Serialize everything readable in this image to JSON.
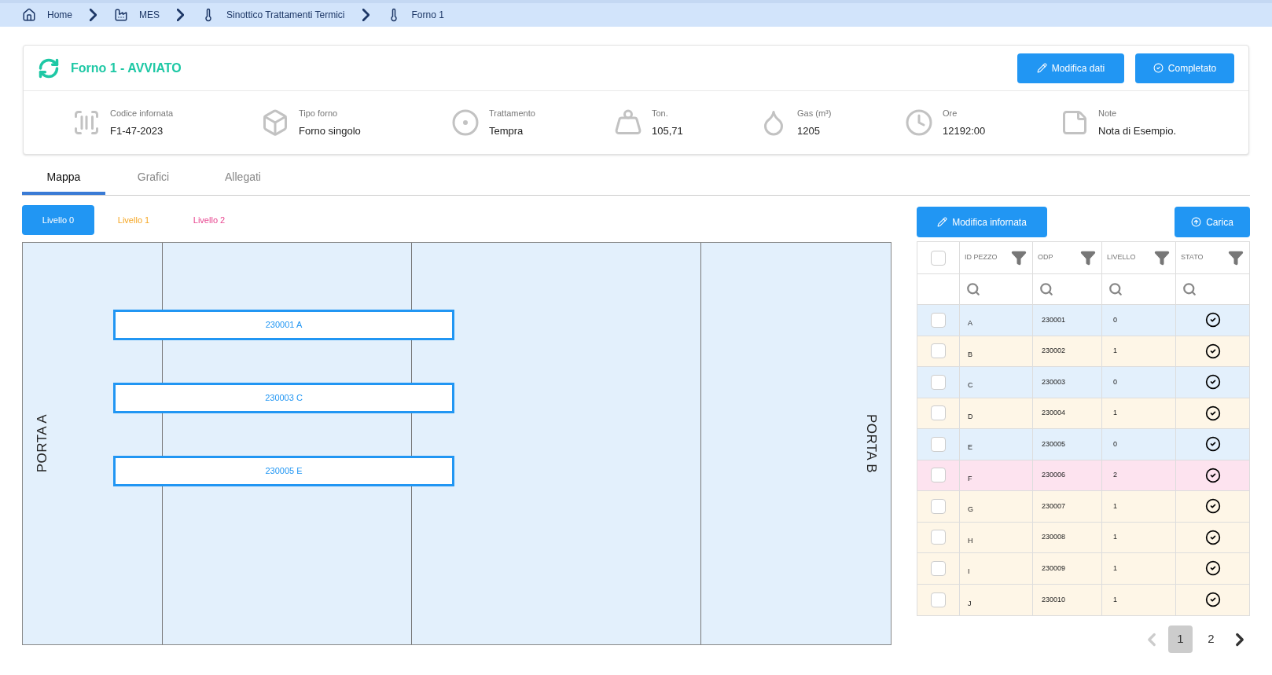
{
  "breadcrumb": [
    {
      "label": "Home"
    },
    {
      "label": "MES"
    },
    {
      "label": "Sinottico Trattamenti Termici"
    },
    {
      "label": "Forno 1"
    }
  ],
  "header": {
    "title": "Forno 1 - AVVIATO",
    "buttons": [
      "Modifica dati",
      "Completato"
    ]
  },
  "info": [
    {
      "label": "Codice infornata",
      "value": "F1-47-2023"
    },
    {
      "label": "Tipo forno",
      "value": "Forno singolo"
    },
    {
      "label": "Trattamento",
      "value": "Tempra"
    },
    {
      "label": "Ton.",
      "value": "105,71"
    },
    {
      "label": "Gas (m³)",
      "value": "1205"
    },
    {
      "label": "Ore",
      "value": "12192:00"
    },
    {
      "label": "Note",
      "value": "Nota di Esempio."
    }
  ],
  "tabs": [
    {
      "label": "Mappa",
      "selected": true
    },
    {
      "label": "Grafici",
      "selected": false
    },
    {
      "label": "Allegati",
      "selected": false
    }
  ],
  "levels": [
    {
      "label": "Livello 0",
      "selected": true,
      "kind": "level0"
    },
    {
      "label": "Livello 1",
      "selected": false,
      "kind": "level1"
    },
    {
      "label": "Livello 2",
      "selected": false,
      "kind": "level2"
    }
  ],
  "map": {
    "door_left": "PORTA A",
    "door_right": "PORTA B",
    "pieces": [
      {
        "label": "230001 A"
      },
      {
        "label": "230003 C"
      },
      {
        "label": "230005 E"
      }
    ]
  },
  "table": {
    "buttons": [
      "Modifica infornata",
      "Carica"
    ],
    "columns": [
      "ID PEZZO",
      "ODP",
      "LIVELLO",
      "STATO"
    ],
    "select_all": {
      "checked": false
    },
    "rows": [
      {
        "id": "A",
        "odp": "230001",
        "livello": "0",
        "checked": false,
        "color": "#e3f0fc"
      },
      {
        "id": "B",
        "odp": "230002",
        "livello": "1",
        "checked": false,
        "color": "#fef6e7"
      },
      {
        "id": "C",
        "odp": "230003",
        "livello": "0",
        "checked": false,
        "color": "#e3f0fc"
      },
      {
        "id": "D",
        "odp": "230004",
        "livello": "1",
        "checked": false,
        "color": "#fef6e7"
      },
      {
        "id": "E",
        "odp": "230005",
        "livello": "0",
        "checked": false,
        "color": "#e3f0fc"
      },
      {
        "id": "F",
        "odp": "230006",
        "livello": "2",
        "checked": false,
        "color": "#fde3ef"
      },
      {
        "id": "G",
        "odp": "230007",
        "livello": "1",
        "checked": false,
        "color": "#fef6e7"
      },
      {
        "id": "H",
        "odp": "230008",
        "livello": "1",
        "checked": false,
        "color": "#fef6e7"
      },
      {
        "id": "I",
        "odp": "230009",
        "livello": "1",
        "checked": false,
        "color": "#fef6e7"
      },
      {
        "id": "J",
        "odp": "230010",
        "livello": "1",
        "checked": false,
        "color": "#fef6e7"
      }
    ]
  },
  "pagination": {
    "prev_disabled": true,
    "pages": [
      {
        "label": "1",
        "selected": true
      },
      {
        "label": "2",
        "selected": false
      }
    ]
  }
}
